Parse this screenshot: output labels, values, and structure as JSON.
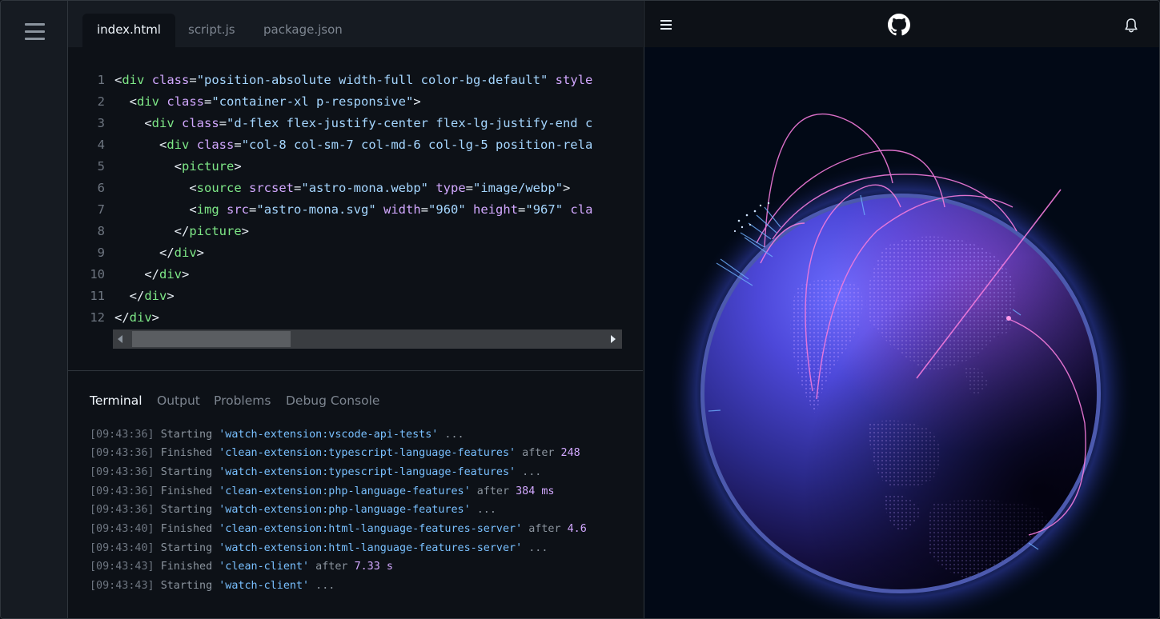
{
  "editor": {
    "tabs": [
      {
        "label": "index.html",
        "active": true
      },
      {
        "label": "script.js",
        "active": false
      },
      {
        "label": "package.json",
        "active": false
      }
    ],
    "lines": [
      {
        "num": "1",
        "indent": "",
        "tokens": [
          [
            "br",
            "<"
          ],
          [
            "tag",
            "div"
          ],
          [
            "br",
            " "
          ],
          [
            "attr",
            "class"
          ],
          [
            "eq",
            "="
          ],
          [
            "str",
            "\"position-absolute width-full color-bg-default\""
          ],
          [
            "br",
            " "
          ],
          [
            "attr",
            "style"
          ]
        ]
      },
      {
        "num": "2",
        "indent": "  ",
        "tokens": [
          [
            "br",
            "<"
          ],
          [
            "tag",
            "div"
          ],
          [
            "br",
            " "
          ],
          [
            "attr",
            "class"
          ],
          [
            "eq",
            "="
          ],
          [
            "str",
            "\"container-xl p-responsive\""
          ],
          [
            "br",
            ">"
          ]
        ]
      },
      {
        "num": "3",
        "indent": "    ",
        "tokens": [
          [
            "br",
            "<"
          ],
          [
            "tag",
            "div"
          ],
          [
            "br",
            " "
          ],
          [
            "attr",
            "class"
          ],
          [
            "eq",
            "="
          ],
          [
            "str",
            "\"d-flex flex-justify-center flex-lg-justify-end c"
          ]
        ]
      },
      {
        "num": "4",
        "indent": "      ",
        "tokens": [
          [
            "br",
            "<"
          ],
          [
            "tag",
            "div"
          ],
          [
            "br",
            " "
          ],
          [
            "attr",
            "class"
          ],
          [
            "eq",
            "="
          ],
          [
            "str",
            "\"col-8 col-sm-7 col-md-6 col-lg-5 position-rela"
          ]
        ]
      },
      {
        "num": "5",
        "indent": "        ",
        "tokens": [
          [
            "br",
            "<"
          ],
          [
            "tag",
            "picture"
          ],
          [
            "br",
            ">"
          ]
        ]
      },
      {
        "num": "6",
        "indent": "          ",
        "tokens": [
          [
            "br",
            "<"
          ],
          [
            "tag",
            "source"
          ],
          [
            "br",
            " "
          ],
          [
            "attr",
            "srcset"
          ],
          [
            "eq",
            "="
          ],
          [
            "str",
            "\"astro-mona.webp\""
          ],
          [
            "br",
            " "
          ],
          [
            "attr",
            "type"
          ],
          [
            "eq",
            "="
          ],
          [
            "str",
            "\"image/webp\""
          ],
          [
            "br",
            ">"
          ]
        ]
      },
      {
        "num": "7",
        "indent": "          ",
        "tokens": [
          [
            "br",
            "<"
          ],
          [
            "tag",
            "img"
          ],
          [
            "br",
            " "
          ],
          [
            "attr",
            "src"
          ],
          [
            "eq",
            "="
          ],
          [
            "str",
            "\"astro-mona.svg\""
          ],
          [
            "br",
            " "
          ],
          [
            "attr",
            "width"
          ],
          [
            "eq",
            "="
          ],
          [
            "str",
            "\"960\""
          ],
          [
            "br",
            " "
          ],
          [
            "attr",
            "height"
          ],
          [
            "eq",
            "="
          ],
          [
            "str",
            "\"967\""
          ],
          [
            "br",
            " "
          ],
          [
            "attr",
            "cla"
          ]
        ]
      },
      {
        "num": "8",
        "indent": "        ",
        "tokens": [
          [
            "br",
            "</"
          ],
          [
            "tag",
            "picture"
          ],
          [
            "br",
            ">"
          ]
        ]
      },
      {
        "num": "9",
        "indent": "      ",
        "tokens": [
          [
            "br",
            "</"
          ],
          [
            "tag",
            "div"
          ],
          [
            "br",
            ">"
          ]
        ]
      },
      {
        "num": "10",
        "indent": "    ",
        "tokens": [
          [
            "br",
            "</"
          ],
          [
            "tag",
            "div"
          ],
          [
            "br",
            ">"
          ]
        ]
      },
      {
        "num": "11",
        "indent": "  ",
        "tokens": [
          [
            "br",
            "</"
          ],
          [
            "tag",
            "div"
          ],
          [
            "br",
            ">"
          ]
        ]
      },
      {
        "num": "12",
        "indent": "",
        "tokens": [
          [
            "br",
            "</"
          ],
          [
            "tag",
            "div"
          ],
          [
            "br",
            ">"
          ]
        ]
      }
    ]
  },
  "terminal": {
    "tabs": [
      {
        "label": "Terminal",
        "active": true
      },
      {
        "label": "Output",
        "active": false
      },
      {
        "label": "Problems",
        "active": false
      },
      {
        "label": "Debug Console",
        "active": false
      }
    ],
    "lines": [
      {
        "time": "[09:43:36]",
        "verb": "Starting",
        "task": "'watch-extension:vscode-api-tests'",
        "rest": " ...",
        "num": ""
      },
      {
        "time": "[09:43:36]",
        "verb": "Finished",
        "task": "'clean-extension:typescript-language-features'",
        "rest": " after ",
        "num": "248"
      },
      {
        "time": "[09:43:36]",
        "verb": "Starting",
        "task": "'watch-extension:typescript-language-features'",
        "rest": " ...",
        "num": ""
      },
      {
        "time": "[09:43:36]",
        "verb": "Finished",
        "task": "'clean-extension:php-language-features'",
        "rest": " after ",
        "num": "384 ms"
      },
      {
        "time": "[09:43:36]",
        "verb": "Starting",
        "task": "'watch-extension:php-language-features'",
        "rest": " ...",
        "num": ""
      },
      {
        "time": "[09:43:40]",
        "verb": "Finished",
        "task": "'clean-extension:html-language-features-server'",
        "rest": " after ",
        "num": "4.6"
      },
      {
        "time": "[09:43:40]",
        "verb": "Starting",
        "task": "'watch-extension:html-language-features-server'",
        "rest": " ...",
        "num": ""
      },
      {
        "time": "[09:43:43]",
        "verb": "Finished",
        "task": "'clean-client'",
        "rest": " after ",
        "num": "7.33 s"
      },
      {
        "time": "[09:43:43]",
        "verb": "Starting",
        "task": "'watch-client'",
        "rest": " ...",
        "num": ""
      }
    ]
  },
  "preview": {
    "menu_icon": "hamburger-icon",
    "logo_icon": "github-logo",
    "notification_icon": "bell-icon"
  },
  "colors": {
    "tag": "#7ee787",
    "attr": "#d2a8ff",
    "string": "#a5d6ff",
    "task": "#79c0ff",
    "globe_glow": "#4a5cff",
    "arcs": "#f37bdc"
  }
}
